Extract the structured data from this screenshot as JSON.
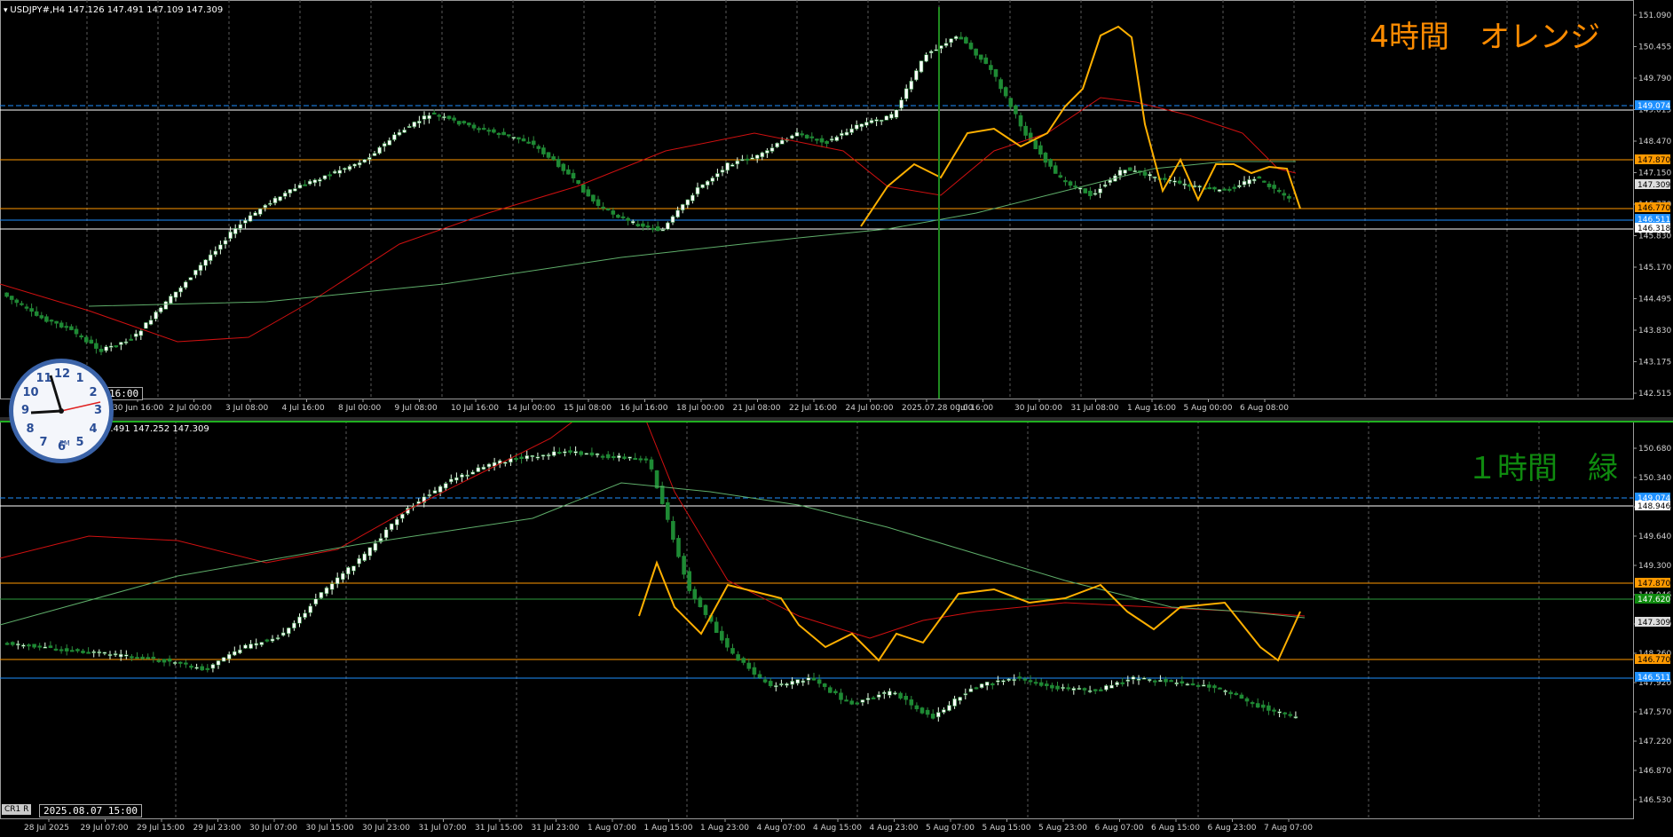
{
  "top_chart": {
    "symbol_label": "USDJPY#,H4  147.126 147.491 147.109 147.309",
    "watermark": "4時間　オレンジ",
    "price_scale": [
      "151.090",
      "150.455",
      "149.790",
      "149.015",
      "148.470",
      "147.150",
      "146.770",
      "145.830",
      "145.170",
      "144.495",
      "143.830",
      "143.175",
      "142.515"
    ],
    "level_tags": [
      {
        "value": "149.074",
        "bg": "#1e90ff",
        "fg": "#ffffff"
      },
      {
        "value": "147.870",
        "bg": "#ff9900",
        "fg": "#000000"
      },
      {
        "value": "147.309",
        "bg": "#dddddd",
        "fg": "#000000"
      },
      {
        "value": "146.770",
        "bg": "#ff9900",
        "fg": "#000000"
      },
      {
        "value": "146.511",
        "bg": "#1e90ff",
        "fg": "#ffffff"
      },
      {
        "value": "146.318",
        "bg": "#ffffff",
        "fg": "#000000"
      }
    ],
    "time_labels": [
      "30 Jun 16:00",
      "2 Jul 00:00",
      "3 Jul 08:00",
      "4 Jul 16:00",
      "8 Jul 00:00",
      "9 Jul 08:00",
      "10 Jul 16:00",
      "14 Jul 00:00",
      "15 Jul 08:00",
      "16 Jul 16:00",
      "18 Jul 00:00",
      "21 Jul 08:00",
      "22 Jul 16:00",
      "24 Jul 00:00",
      "2025.07.28 00:00",
      "Jul 16:00",
      "30 Jul 00:00",
      "31 Jul 08:00",
      "1 Aug 16:00",
      "5 Aug 00:00",
      "6 Aug 08:00"
    ],
    "clock_time_text": "16:00"
  },
  "bottom_chart": {
    "symbol_label": "7.491 147.252 147.309",
    "watermark": "１時間　緑",
    "price_scale": [
      "151.020",
      "150.680",
      "150.340",
      "149.995",
      "149.640",
      "149.300",
      "148.946",
      "148.600",
      "148.260",
      "147.920",
      "147.570",
      "147.220",
      "146.870",
      "146.530"
    ],
    "level_tags": [
      {
        "value": "149.074",
        "bg": "#1e90ff",
        "fg": "#ffffff"
      },
      {
        "value": "148.946",
        "bg": "#ffffff",
        "fg": "#000000"
      },
      {
        "value": "147.870",
        "bg": "#ff9900",
        "fg": "#000000"
      },
      {
        "value": "147.620",
        "bg": "#0f8a0f",
        "fg": "#ffffff"
      },
      {
        "value": "147.309",
        "bg": "#dddddd",
        "fg": "#000000"
      },
      {
        "value": "146.770",
        "bg": "#ff9900",
        "fg": "#000000"
      },
      {
        "value": "146.511",
        "bg": "#1e90ff",
        "fg": "#ffffff"
      }
    ],
    "time_labels": [
      "28 Jul 2025",
      "29 Jul 07:00",
      "29 Jul 15:00",
      "29 Jul 23:00",
      "30 Jul 07:00",
      "30 Jul 15:00",
      "30 Jul 23:00",
      "31 Jul 07:00",
      "31 Jul 15:00",
      "31 Jul 23:00",
      "1 Aug 07:00",
      "1 Aug 15:00",
      "1 Aug 23:00",
      "4 Aug 07:00",
      "4 Aug 15:00",
      "4 Aug 23:00",
      "5 Aug 07:00",
      "5 Aug 15:00",
      "5 Aug 23:00",
      "6 Aug 07:00",
      "6 Aug 15:00",
      "6 Aug 23:00",
      "7 Aug 07:00"
    ],
    "timestamp_box": "2025.08.07 15:00",
    "tab_label": "CR1  R"
  },
  "clock": {
    "numbers": [
      "12",
      "1",
      "2",
      "3",
      "4",
      "5",
      "6",
      "7",
      "8",
      "9",
      "10",
      "11"
    ],
    "pm_label": "PM"
  },
  "colors": {
    "orange": "#ff9900",
    "green": "#0f8a0f",
    "blue": "#1e90ff",
    "ma_red": "#d01010",
    "ma_green": "#5fae6a"
  }
}
